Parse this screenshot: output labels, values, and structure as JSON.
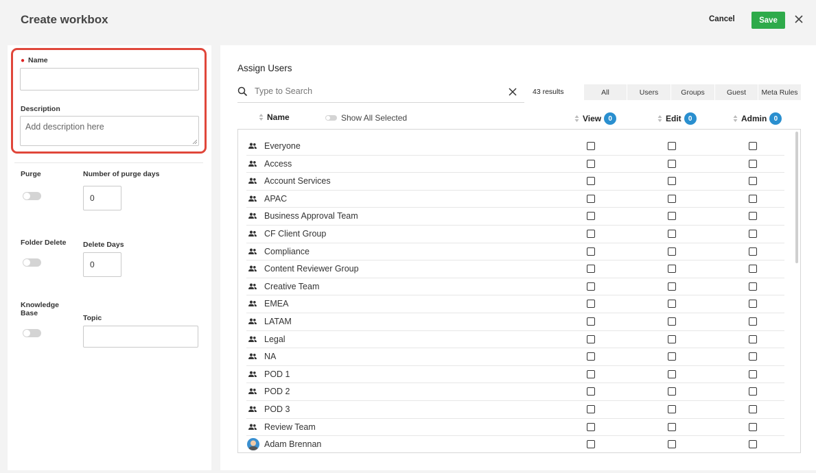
{
  "header": {
    "title": "Create workbox",
    "cancel_label": "Cancel",
    "save_label": "Save"
  },
  "form": {
    "name_label": "Name",
    "name_value": "",
    "description_label": "Description",
    "description_placeholder": "Add description here",
    "purge_label": "Purge",
    "purge_days_label": "Number of purge days",
    "purge_days_value": "0",
    "folder_delete_label": "Folder Delete",
    "delete_days_label": "Delete Days",
    "delete_days_value": "0",
    "knowledge_base_label": "Knowledge Base",
    "topic_label": "Topic",
    "topic_value": ""
  },
  "assign": {
    "title": "Assign Users",
    "search_placeholder": "Type to Search",
    "results": "43 results",
    "filters": [
      "All",
      "Users",
      "Groups",
      "Guest",
      "Meta Rules"
    ],
    "columns": {
      "name": "Name",
      "show_all_selected": "Show All Selected",
      "view": "View",
      "view_count": "0",
      "edit": "Edit",
      "edit_count": "0",
      "admin": "Admin",
      "admin_count": "0"
    },
    "rows": [
      {
        "label": "Everyone",
        "type": "group"
      },
      {
        "label": "Access",
        "type": "group"
      },
      {
        "label": "Account Services",
        "type": "group"
      },
      {
        "label": "APAC",
        "type": "group"
      },
      {
        "label": "Business Approval Team",
        "type": "group"
      },
      {
        "label": "CF Client Group",
        "type": "group"
      },
      {
        "label": "Compliance",
        "type": "group"
      },
      {
        "label": "Content Reviewer Group",
        "type": "group"
      },
      {
        "label": "Creative Team",
        "type": "group"
      },
      {
        "label": "EMEA",
        "type": "group"
      },
      {
        "label": "LATAM",
        "type": "group"
      },
      {
        "label": "Legal",
        "type": "group"
      },
      {
        "label": "NA",
        "type": "group"
      },
      {
        "label": "POD 1",
        "type": "group"
      },
      {
        "label": "POD 2",
        "type": "group"
      },
      {
        "label": "POD 3",
        "type": "group"
      },
      {
        "label": "Review Team",
        "type": "group"
      },
      {
        "label": "Adam Brennan",
        "type": "user"
      }
    ]
  },
  "colors": {
    "accent": "#2a8fcf",
    "save": "#2eaa4a",
    "highlight": "#e0463a"
  }
}
